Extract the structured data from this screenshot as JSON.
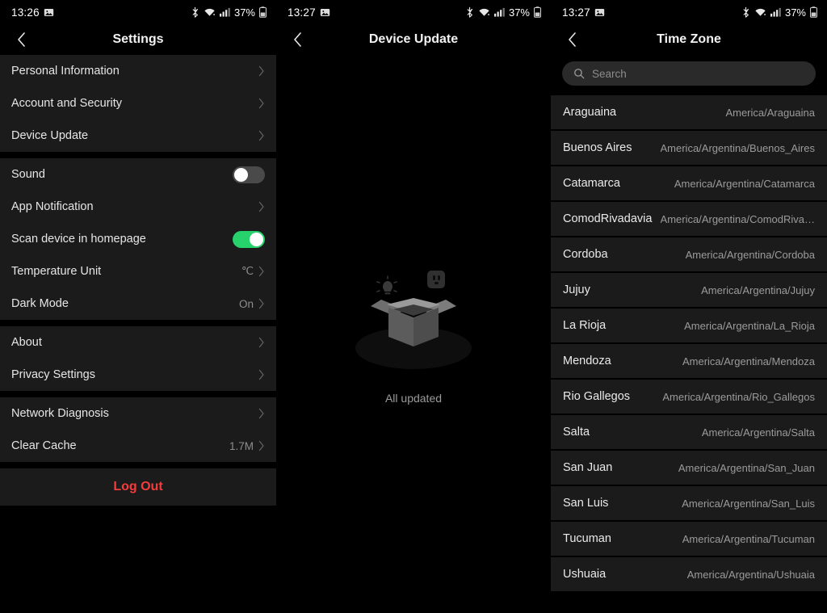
{
  "panels": {
    "settings": {
      "status_bar": {
        "time": "13:26",
        "battery_percent": "37%"
      },
      "nav": {
        "title": "Settings",
        "back_icon": "chevron-left-icon"
      },
      "groups": [
        {
          "rows": [
            {
              "label": "Personal Information",
              "type": "chevron"
            },
            {
              "label": "Account and Security",
              "type": "chevron"
            },
            {
              "label": "Device Update",
              "type": "chevron"
            }
          ]
        },
        {
          "rows": [
            {
              "label": "Sound",
              "type": "toggle",
              "state": "off"
            },
            {
              "label": "App Notification",
              "type": "chevron"
            },
            {
              "label": "Scan device in homepage",
              "type": "toggle",
              "state": "on"
            },
            {
              "label": "Temperature Unit",
              "type": "chevron",
              "value": "℃"
            },
            {
              "label": "Dark Mode",
              "type": "chevron",
              "value": "On"
            }
          ]
        },
        {
          "rows": [
            {
              "label": "About",
              "type": "chevron"
            },
            {
              "label": "Privacy Settings",
              "type": "chevron"
            }
          ]
        },
        {
          "rows": [
            {
              "label": "Network Diagnosis",
              "type": "chevron"
            },
            {
              "label": "Clear Cache",
              "type": "chevron",
              "value": "1.7M"
            }
          ]
        }
      ],
      "logout_label": "Log Out",
      "logout_color": "#f53b3b"
    },
    "device_update": {
      "status_bar": {
        "time": "13:27",
        "battery_percent": "37%"
      },
      "nav": {
        "title": "Device Update",
        "back_icon": "chevron-left-icon"
      },
      "empty_state": {
        "text": "All updated",
        "illustration": "open-box-icon",
        "decor_icons": [
          "bulb-icon",
          "power-outlet-icon"
        ]
      }
    },
    "time_zone": {
      "status_bar": {
        "time": "13:27",
        "battery_percent": "37%"
      },
      "nav": {
        "title": "Time Zone",
        "back_icon": "chevron-left-icon"
      },
      "search": {
        "placeholder": "Search",
        "value": "",
        "icon": "search-icon"
      },
      "rows": [
        {
          "name": "Araguaina",
          "id": "America/Araguaina"
        },
        {
          "name": "Buenos Aires",
          "id": "America/Argentina/Buenos_Aires"
        },
        {
          "name": "Catamarca",
          "id": "America/Argentina/Catamarca"
        },
        {
          "name": "ComodRivadavia",
          "id": "America/Argentina/ComodRiva…"
        },
        {
          "name": "Cordoba",
          "id": "America/Argentina/Cordoba"
        },
        {
          "name": "Jujuy",
          "id": "America/Argentina/Jujuy"
        },
        {
          "name": "La Rioja",
          "id": "America/Argentina/La_Rioja"
        },
        {
          "name": "Mendoza",
          "id": "America/Argentina/Mendoza"
        },
        {
          "name": "Rio Gallegos",
          "id": "America/Argentina/Rio_Gallegos"
        },
        {
          "name": "Salta",
          "id": "America/Argentina/Salta"
        },
        {
          "name": "San Juan",
          "id": "America/Argentina/San_Juan"
        },
        {
          "name": "San Luis",
          "id": "America/Argentina/San_Luis"
        },
        {
          "name": "Tucuman",
          "id": "America/Argentina/Tucuman"
        },
        {
          "name": "Ushuaia",
          "id": "America/Argentina/Ushuaia"
        }
      ]
    }
  }
}
